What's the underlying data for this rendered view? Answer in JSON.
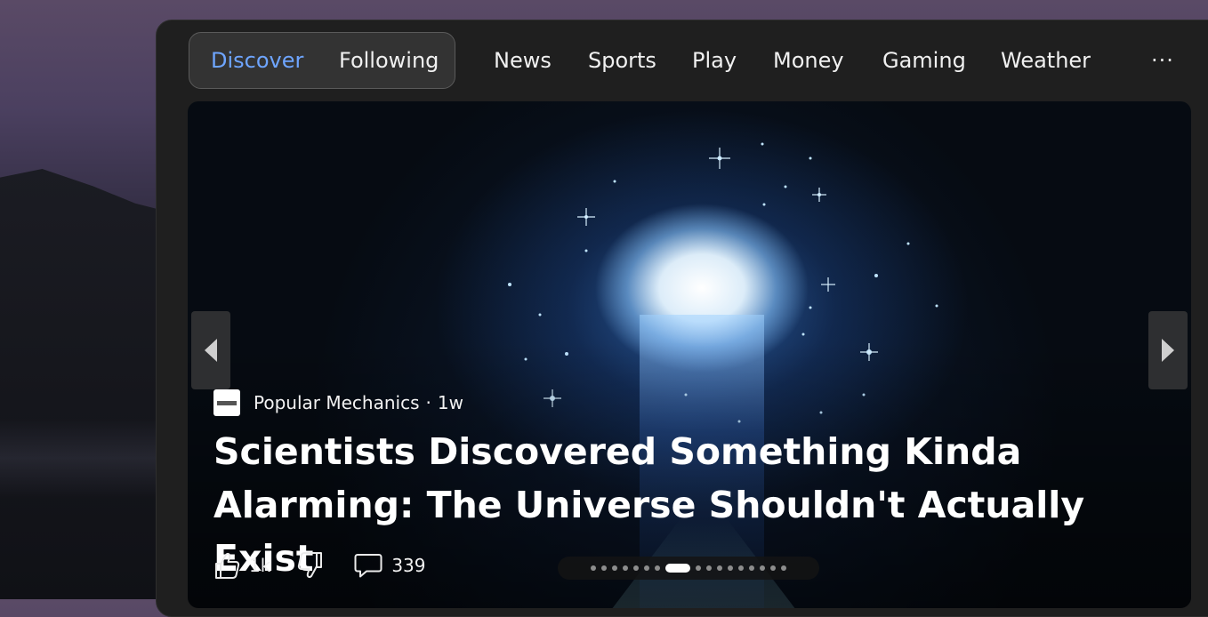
{
  "nav": {
    "discover_label": "Discover",
    "following_label": "Following",
    "items": [
      "News",
      "Sports",
      "Play",
      "Money",
      "Gaming",
      "Weather"
    ],
    "more_label": "···"
  },
  "hero": {
    "source_name": "Popular Mechanics",
    "separator": "·",
    "age": "1w",
    "headline": "Scientists Discovered Something Kinda Alarming: The Universe Shouldn't Actually Exist",
    "likes": "1k",
    "comments": "339",
    "carousel_total": 17,
    "carousel_active": 8
  },
  "colors": {
    "accent": "#6ea5ff",
    "panel": "#1f1f1f",
    "text": "#f2f2f2"
  },
  "icons": {
    "prev": "chevron-left-icon",
    "next": "chevron-right-icon",
    "like": "thumbs-up-icon",
    "dislike": "thumbs-down-icon",
    "comment": "speech-bubble-icon"
  }
}
